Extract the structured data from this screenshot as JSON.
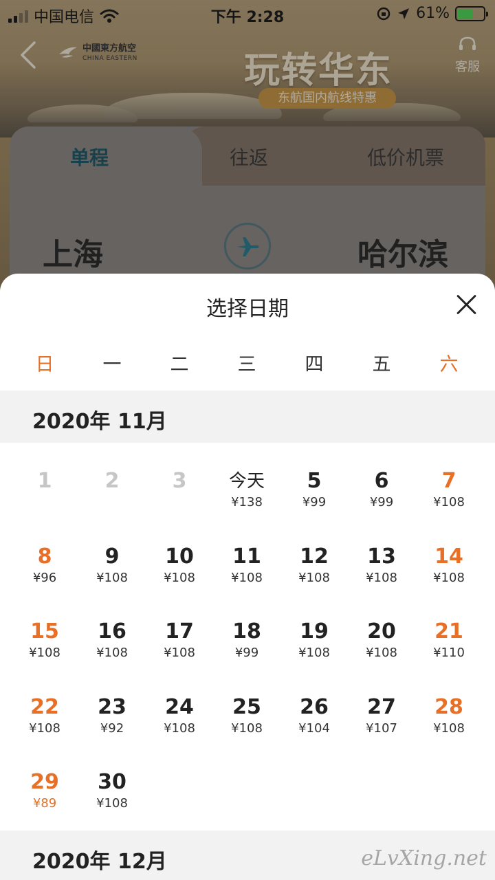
{
  "status_bar": {
    "carrier": "中国电信",
    "time": "下午 2:28",
    "battery": "61%",
    "battery_level": 0.61
  },
  "header": {
    "brand_cn": "中國東方航空",
    "brand_en": "CHINA EASTERN",
    "banner_title": "玩转华东",
    "banner_subtitle": "东航国内航线特惠",
    "service_label": "客服"
  },
  "booking_card": {
    "tabs": [
      {
        "label": "单程",
        "active": true
      },
      {
        "label": "往返",
        "active": false
      },
      {
        "label": "低价机票",
        "active": false
      }
    ],
    "origin": "上海",
    "destination": "哈尔滨"
  },
  "date_picker": {
    "title": "选择日期",
    "weekdays": [
      "日",
      "一",
      "二",
      "三",
      "四",
      "五",
      "六"
    ],
    "months": [
      {
        "label": "2020年 11月",
        "days": [
          {
            "day": "1",
            "price": "",
            "state": "past"
          },
          {
            "day": "2",
            "price": "",
            "state": "past"
          },
          {
            "day": "3",
            "price": "",
            "state": "past"
          },
          {
            "day": "今天",
            "price": "¥138",
            "state": "today"
          },
          {
            "day": "5",
            "price": "¥99",
            "state": "normal"
          },
          {
            "day": "6",
            "price": "¥99",
            "state": "normal"
          },
          {
            "day": "7",
            "price": "¥108",
            "state": "weekend"
          },
          {
            "day": "8",
            "price": "¥96",
            "state": "weekend"
          },
          {
            "day": "9",
            "price": "¥108",
            "state": "normal"
          },
          {
            "day": "10",
            "price": "¥108",
            "state": "normal"
          },
          {
            "day": "11",
            "price": "¥108",
            "state": "normal"
          },
          {
            "day": "12",
            "price": "¥108",
            "state": "normal"
          },
          {
            "day": "13",
            "price": "¥108",
            "state": "normal"
          },
          {
            "day": "14",
            "price": "¥108",
            "state": "weekend"
          },
          {
            "day": "15",
            "price": "¥108",
            "state": "weekend"
          },
          {
            "day": "16",
            "price": "¥108",
            "state": "normal"
          },
          {
            "day": "17",
            "price": "¥108",
            "state": "normal"
          },
          {
            "day": "18",
            "price": "¥99",
            "state": "normal"
          },
          {
            "day": "19",
            "price": "¥108",
            "state": "normal"
          },
          {
            "day": "20",
            "price": "¥108",
            "state": "normal"
          },
          {
            "day": "21",
            "price": "¥110",
            "state": "weekend"
          },
          {
            "day": "22",
            "price": "¥108",
            "state": "weekend"
          },
          {
            "day": "23",
            "price": "¥92",
            "state": "normal"
          },
          {
            "day": "24",
            "price": "¥108",
            "state": "normal"
          },
          {
            "day": "25",
            "price": "¥108",
            "state": "normal"
          },
          {
            "day": "26",
            "price": "¥104",
            "state": "normal"
          },
          {
            "day": "27",
            "price": "¥107",
            "state": "normal"
          },
          {
            "day": "28",
            "price": "¥108",
            "state": "weekend"
          },
          {
            "day": "29",
            "price": "¥89",
            "state": "weekend-lowest"
          },
          {
            "day": "30",
            "price": "¥108",
            "state": "normal"
          }
        ]
      },
      {
        "label": "2020年 12月",
        "days": []
      }
    ]
  },
  "watermark": "eLvXing.net",
  "colors": {
    "weekend": "#e86f26",
    "lowest_price": "#e86f26",
    "past_day": "#c6c6c6",
    "active_tab": "#1f5a6b",
    "month_bar_bg": "#f2f2f2"
  }
}
